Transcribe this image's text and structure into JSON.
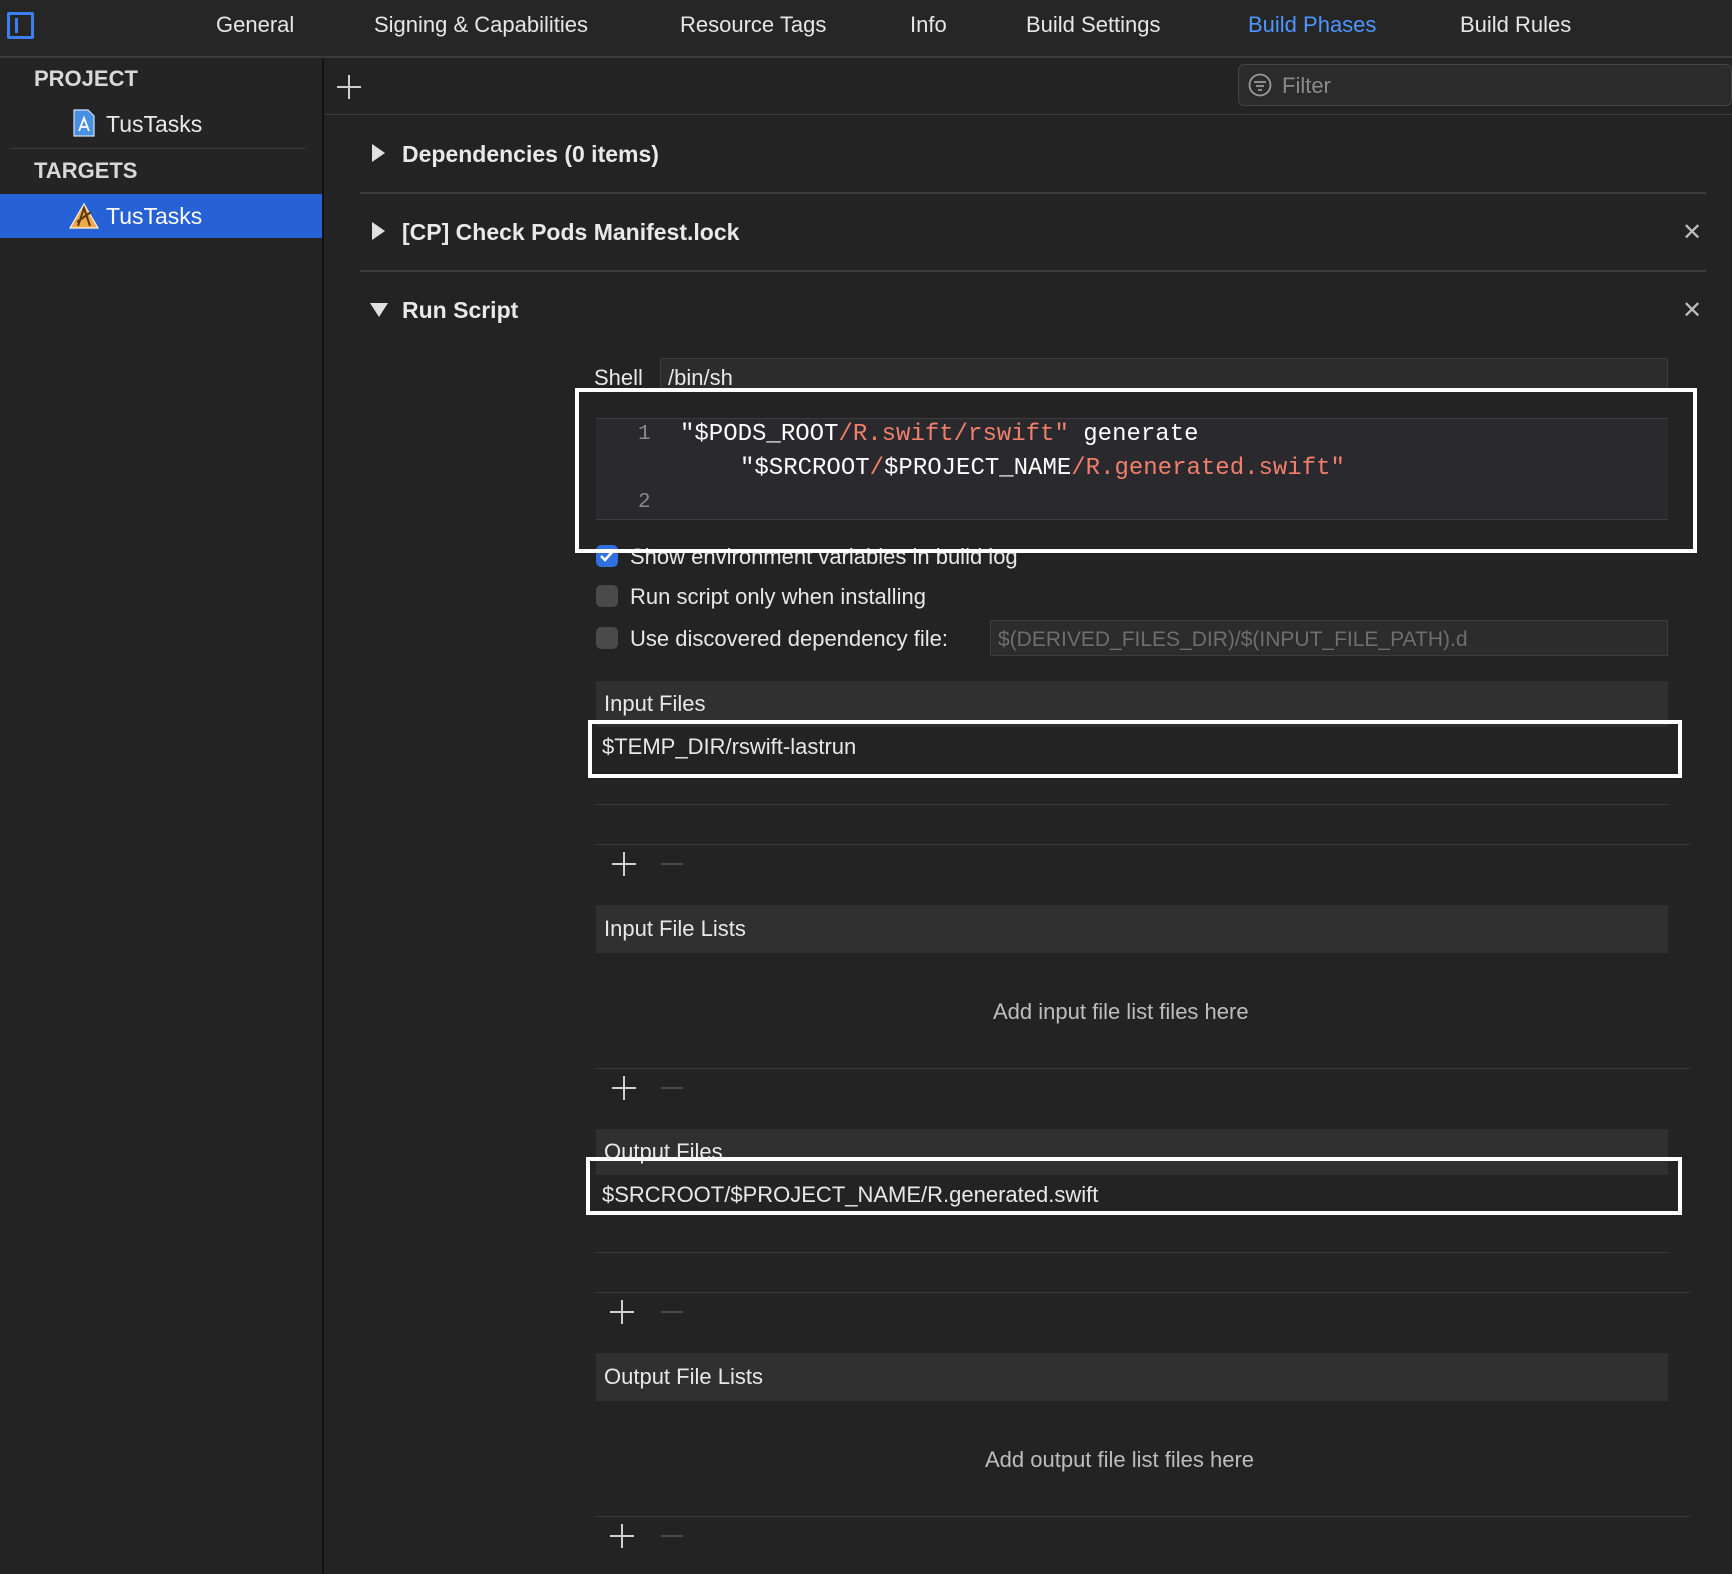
{
  "tabs": [
    {
      "label": "General",
      "active": false
    },
    {
      "label": "Signing & Capabilities",
      "active": false
    },
    {
      "label": "Resource Tags",
      "active": false
    },
    {
      "label": "Info",
      "active": false
    },
    {
      "label": "Build Settings",
      "active": false
    },
    {
      "label": "Build Phases",
      "active": true
    },
    {
      "label": "Build Rules",
      "active": false
    }
  ],
  "sidebar": {
    "project_header": "PROJECT",
    "project_item": "TusTasks",
    "targets_header": "TARGETS",
    "target_item": "TusTasks"
  },
  "filter": {
    "placeholder": "Filter"
  },
  "phases": {
    "dependencies": "Dependencies (0 items)",
    "check_pods": "[CP] Check Pods Manifest.lock",
    "run_script": "Run Script"
  },
  "run_script": {
    "shell_label": "Shell",
    "shell_value": "/bin/sh",
    "line1_no": "1",
    "line2_no": "2",
    "line1_a": "\"$PODS_ROOT",
    "line1_b": "/R.swift/rswift\"",
    "line1_c": " generate",
    "line1b_a": "\"$SRCROOT",
    "line1b_b": "/",
    "line1b_c": "$PROJECT_NAME",
    "line1b_d": "/R.generated.swift\"",
    "opt_show_env": "Show environment variables in build log",
    "opt_show_env_checked": true,
    "opt_install_only": "Run script only when installing",
    "opt_install_only_checked": false,
    "opt_dep_file": "Use discovered dependency file:",
    "opt_dep_file_checked": false,
    "dep_file_placeholder": "$(DERIVED_FILES_DIR)/$(INPUT_FILE_PATH).d",
    "input_files_header": "Input Files",
    "input_file_1": "$TEMP_DIR/rswift-lastrun",
    "input_file_lists_header": "Input File Lists",
    "input_file_lists_placeholder": "Add input file list files here",
    "output_files_header": "Output Files",
    "output_file_1": "$SRCROOT/$PROJECT_NAME/R.generated.swift",
    "output_file_lists_header": "Output File Lists",
    "output_file_lists_placeholder": "Add output file list files here"
  },
  "colors": {
    "accent": "#4d95ff",
    "selection": "#2661d5",
    "code_string": "#f07f6b",
    "highlight_box": "#ffffff"
  }
}
